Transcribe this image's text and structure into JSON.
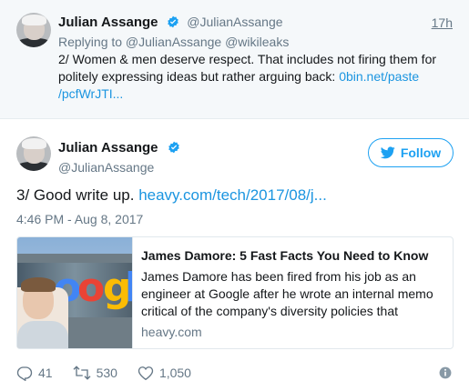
{
  "reply_tweet": {
    "author_name": "Julian Assange",
    "author_handle": "@JulianAssange",
    "time": "17h",
    "replying_to": "Replying to @JulianAssange @wikileaks",
    "text_main": "2/ Women & men deserve respect. That includes not firing them for politely expressing ideas but rather arguing back: ",
    "link": "0bin.net/paste /pcfWrJTI...",
    "verified_icon": "verified-badge-icon"
  },
  "main_tweet": {
    "author_name": "Julian Assange",
    "author_handle": "@JulianAssange",
    "follow_label": "Follow",
    "text_main": "3/ Good write up. ",
    "link": "heavy.com/tech/2017/08/j...",
    "timestamp": "4:46 PM - Aug 8, 2017",
    "card": {
      "image_alt": "Google logo behind James Damore photo",
      "title": "James Damore: 5 Fast Facts You Need to Know",
      "description": "James Damore has been fired from his job as an engineer at Google after he wrote an internal memo critical of the company's diversity policies that",
      "domain": "heavy.com"
    },
    "actions": {
      "replies": "41",
      "retweets": "530",
      "likes": "1,050"
    }
  },
  "colors": {
    "twitter_blue": "#1da1f2",
    "link": "#1b95e0",
    "muted": "#657786",
    "reply_bg": "#f5f8fa"
  },
  "icons": [
    "verified-badge-icon",
    "twitter-bird-icon",
    "reply-icon",
    "retweet-icon",
    "heart-icon",
    "info-icon"
  ]
}
